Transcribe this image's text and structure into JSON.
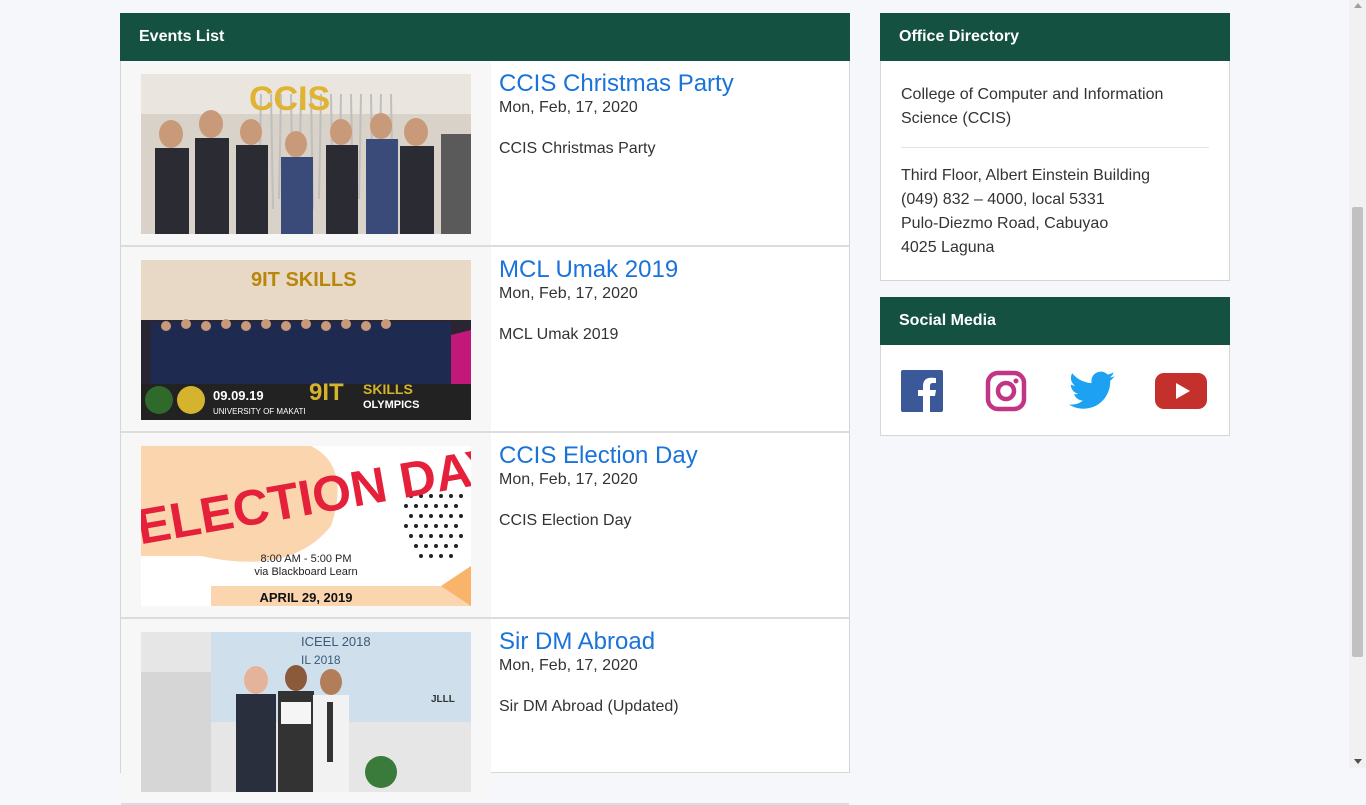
{
  "events_panel": {
    "title": "Events List",
    "items": [
      {
        "title": "CCIS Christmas Party",
        "date": "Mon, Feb, 17, 2020",
        "description": "CCIS Christmas Party",
        "image_text": "CCIS"
      },
      {
        "title": "MCL Umak 2019",
        "date": "Mon, Feb, 17, 2020",
        "description": "MCL Umak 2019",
        "image_text": "9IT SKILLS OLYMPICS",
        "image_subtext": "09.09.19",
        "image_caption": "UNIVERSITY OF MAKATI"
      },
      {
        "title": "CCIS Election Day",
        "date": "Mon, Feb, 17, 2020",
        "description": "CCIS Election Day",
        "image_text": "ELECTION DAY",
        "image_time": "8:00 AM - 5:00 PM",
        "image_via": "via Blackboard Learn",
        "image_date": "APRIL 29, 2019"
      },
      {
        "title": "Sir DM Abroad",
        "date": "Mon, Feb, 17, 2020",
        "description": "Sir DM Abroad (Updated)",
        "image_text": "ICEEL 2018",
        "image_subtext": "IL 2018",
        "image_logo": "JLLL"
      }
    ]
  },
  "office_panel": {
    "title": "Office Directory",
    "name": "College of Computer and Information Science (CCIS)",
    "address_lines": [
      "Third Floor, Albert Einstein Building",
      "(049) 832 – 4000, local 5331",
      "Pulo-Diezmo Road, Cabuyao",
      "4025 Laguna"
    ]
  },
  "social_panel": {
    "title": "Social Media",
    "icons": [
      "facebook-icon",
      "instagram-icon",
      "twitter-icon",
      "youtube-icon"
    ]
  },
  "colors": {
    "header_green": "#155140",
    "link_blue": "#1a73d9",
    "facebook": "#3b5998",
    "instagram": "#c13584",
    "twitter": "#1da1f2",
    "youtube": "#c4302b"
  }
}
